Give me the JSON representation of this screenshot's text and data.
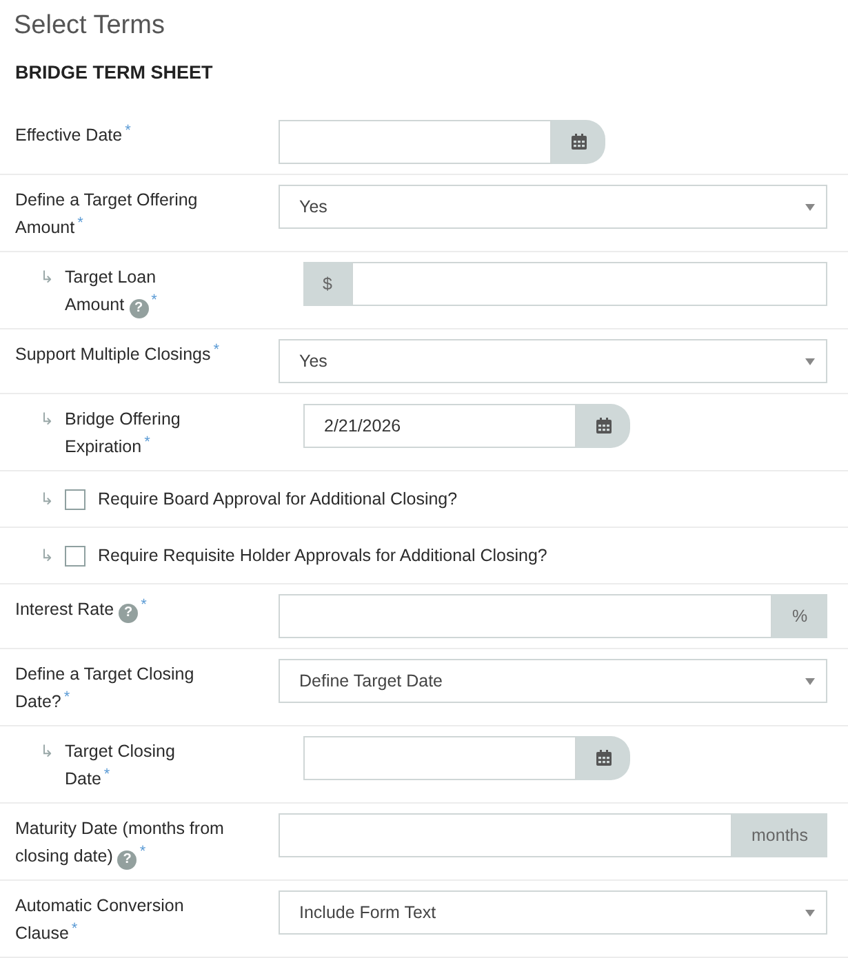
{
  "page_title": "Select Terms",
  "section_title": "BRIDGE TERM SHEET",
  "rows": [
    {
      "kind": "date",
      "label": "Effective Date",
      "required": "*"
    },
    {
      "kind": "select",
      "label": "Define a Target Offering Amount",
      "required": "*",
      "value": "Yes"
    },
    {
      "kind": "prefix",
      "arrow": "↳",
      "label": "Target Loan Amount",
      "help": "?",
      "required": "*",
      "addon": "$"
    },
    {
      "kind": "select",
      "label": "Support Multiple Closings",
      "required": "*",
      "value": "Yes"
    },
    {
      "kind": "date",
      "arrow": "↳",
      "label": "Bridge Offering Expiration",
      "required": "*",
      "value": "2/21/2026"
    },
    {
      "kind": "checkbox",
      "arrow": "↳",
      "label": "Require Board Approval for Additional Closing?",
      "checked": false
    },
    {
      "kind": "checkbox",
      "arrow": "↳",
      "label": "Require Requisite Holder Approvals for Additional Closing?",
      "checked": false
    },
    {
      "kind": "suffix",
      "label": "Interest Rate",
      "help": "?",
      "required": "*",
      "addon": "%"
    },
    {
      "kind": "select",
      "label": "Define a Target Closing Date?",
      "required": "*",
      "value": "Define Target Date"
    },
    {
      "kind": "date",
      "arrow": "↳",
      "label": "Target Closing Date",
      "required": "*"
    },
    {
      "kind": "suffix",
      "label": "Maturity Date (months from closing date)",
      "help": "?",
      "required": "*",
      "addon": "months"
    },
    {
      "kind": "select",
      "label": "Automatic Conversion Clause",
      "required": "*",
      "value": "Include Form Text"
    }
  ]
}
